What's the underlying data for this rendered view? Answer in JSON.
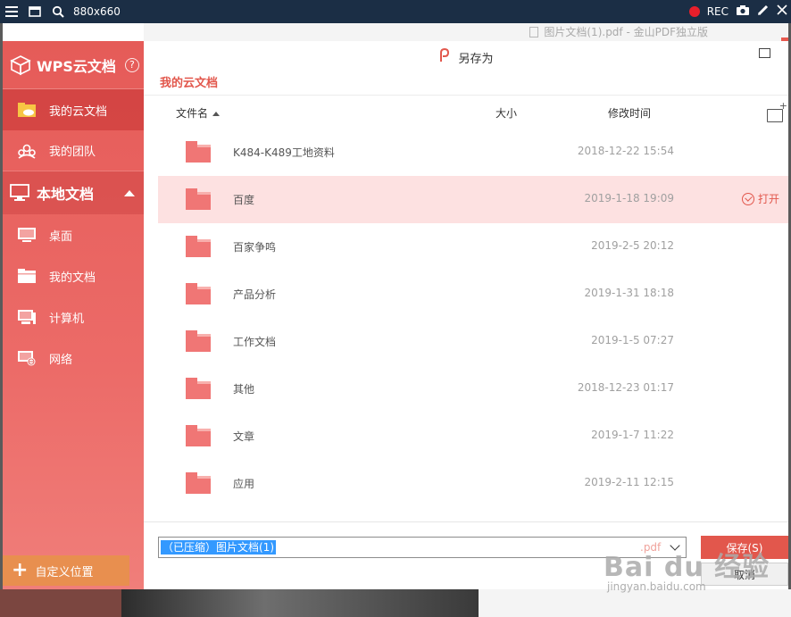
{
  "recorder": {
    "size": "880x660",
    "rec_label": "REC"
  },
  "window": {
    "title": "图片文档(1).pdf - 金山PDF独立版"
  },
  "sidebar": {
    "brand": "WPS云文档",
    "help": "?",
    "cloud_items": [
      {
        "label": "我的云文档",
        "icon": "cloud-folder-icon"
      },
      {
        "label": "我的团队",
        "icon": "team-icon"
      }
    ],
    "local_section": "本地文档",
    "local_items": [
      {
        "label": "桌面",
        "icon": "desktop-icon"
      },
      {
        "label": "我的文档",
        "icon": "folder-icon"
      },
      {
        "label": "计算机",
        "icon": "computer-icon"
      },
      {
        "label": "网络",
        "icon": "network-icon"
      }
    ],
    "custom_location": "自定义位置"
  },
  "dialog": {
    "title": "另存为",
    "breadcrumb": "我的云文档",
    "columns": {
      "name": "文件名",
      "size": "大小",
      "modified": "修改时间"
    },
    "rows": [
      {
        "name": "K484-K489工地资料",
        "date": "2018-12-22 15:54"
      },
      {
        "name": "百度",
        "date": "2019-1-18 19:09",
        "action": "打开"
      },
      {
        "name": "百家争鸣",
        "date": "2019-2-5 20:12"
      },
      {
        "name": "产品分析",
        "date": "2019-1-31 18:18"
      },
      {
        "name": "工作文档",
        "date": "2019-1-5 07:27"
      },
      {
        "name": "其他",
        "date": "2018-12-23 01:17"
      },
      {
        "name": "文章",
        "date": "2019-1-7 11:22"
      },
      {
        "name": "应用",
        "date": "2019-2-11 12:15"
      }
    ],
    "filename": "（已压缩）图片文档(1)",
    "extension": ".pdf",
    "save_label": "保存(S)",
    "cancel_label": "取消"
  },
  "watermark": {
    "big": "Bai du 经验",
    "small": "jingyan.baidu.com"
  },
  "colors": {
    "accent": "#e2574c",
    "sidebar": "#ec6b68",
    "selected_row": "#fde1e1",
    "custom_button": "#e88f4f"
  }
}
